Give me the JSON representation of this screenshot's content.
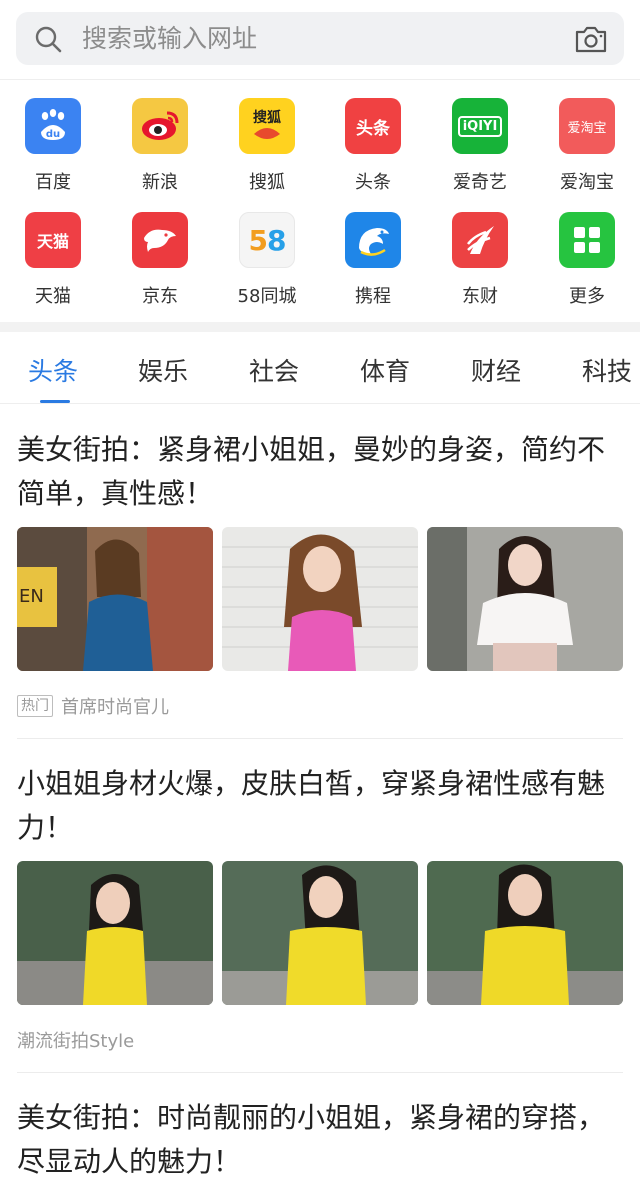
{
  "search": {
    "placeholder": "搜索或输入网址",
    "search_icon": "search-icon",
    "camera_icon": "camera-icon"
  },
  "apps": [
    {
      "label": "百度",
      "icon": "baidu-paw-icon",
      "tile_text": "du",
      "color": "#3b83f2"
    },
    {
      "label": "新浪",
      "icon": "sina-eye-icon",
      "tile_text": "",
      "color": "#f5c842"
    },
    {
      "label": "搜狐",
      "icon": "sohu-fox-icon",
      "tile_text": "搜狐",
      "color": "#ffd21f"
    },
    {
      "label": "头条",
      "icon": "toutiao-icon",
      "tile_text": "头条",
      "color": "#f04142"
    },
    {
      "label": "爱奇艺",
      "icon": "iqiyi-icon",
      "tile_text": "iQIYI",
      "color": "#17b339"
    },
    {
      "label": "爱淘宝",
      "icon": "aitaobao-icon",
      "tile_text": "爱淘宝",
      "color": "#f25b5b"
    },
    {
      "label": "天猫",
      "icon": "tmall-icon",
      "tile_text": "天猫",
      "color": "#ef3f45"
    },
    {
      "label": "京东",
      "icon": "jd-dog-icon",
      "tile_text": "",
      "color": "#ec3a3f"
    },
    {
      "label": "58同城",
      "icon": "58-icon",
      "tile_text": "58",
      "color": "#f5f5f5"
    },
    {
      "label": "携程",
      "icon": "ctrip-dolphin-icon",
      "tile_text": "",
      "color": "#1f86e8"
    },
    {
      "label": "东财",
      "icon": "dongcai-icon",
      "tile_text": "",
      "color": "#ec4243"
    },
    {
      "label": "更多",
      "icon": "more-grid-icon",
      "tile_text": "",
      "color": "#26c440"
    }
  ],
  "tabs": [
    "头条",
    "娱乐",
    "社会",
    "体育",
    "财经",
    "科技"
  ],
  "accent_color": "#2a7ae2",
  "articles": [
    {
      "title": "美女街拍：紧身裙小姐姐，曼妙的身姿，简约不简单，真性感！",
      "badge": "热门",
      "source": "首席时尚官儿"
    },
    {
      "title": "小姐姐身材火爆，皮肤白皙，穿紧身裙性感有魅力！",
      "badge": "",
      "source": "潮流街拍Style"
    },
    {
      "title": "美女街拍：时尚靓丽的小姐姐，紧身裙的穿搭，尽显动人的魅力！",
      "badge": "",
      "source": ""
    }
  ]
}
